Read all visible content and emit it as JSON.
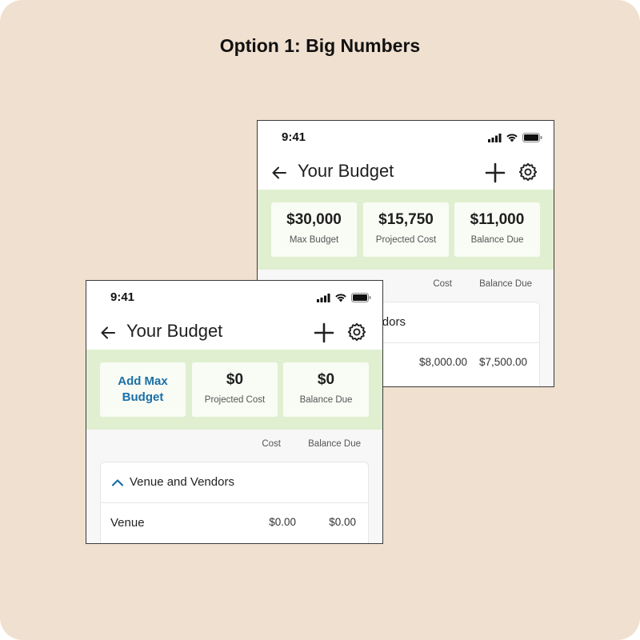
{
  "heading": "Option 1: Big Numbers",
  "back_screen": {
    "status": {
      "time": "9:41"
    },
    "nav": {
      "title": "Your Budget"
    },
    "cards": [
      {
        "value": "$30,000",
        "label": "Max Budget"
      },
      {
        "value": "$15,750",
        "label": "Projected Cost"
      },
      {
        "value": "$11,000",
        "label": "Balance Due"
      }
    ],
    "columns": {
      "cost": "Cost",
      "balance": "Balance Due"
    },
    "group": {
      "title": "Venue and Vendors"
    },
    "row": {
      "cost": "$8,000.00",
      "balance": "$7,500.00"
    }
  },
  "front_screen": {
    "status": {
      "time": "9:41"
    },
    "nav": {
      "title": "Your Budget"
    },
    "add_max_budget": "Add Max Budget",
    "cards": [
      {
        "value": "$0",
        "label": "Projected Cost"
      },
      {
        "value": "$0",
        "label": "Balance Due"
      }
    ],
    "columns": {
      "cost": "Cost",
      "balance": "Balance Due"
    },
    "group": {
      "title": "Venue and Vendors"
    },
    "row": {
      "name": "Venue",
      "cost": "$0.00",
      "balance": "$0.00"
    }
  },
  "colors": {
    "background": "#f0e0cf",
    "summary_band": "#e0efd0",
    "link": "#1b6fa8"
  },
  "icons": [
    "back-arrow-icon",
    "plus-icon",
    "gear-icon",
    "chevron-up-icon",
    "signal-icon",
    "wifi-icon",
    "battery-icon"
  ]
}
